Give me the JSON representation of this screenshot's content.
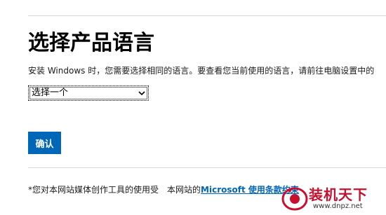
{
  "page": {
    "title": "选择产品语言",
    "instruction": "安装 Windows 时，您需要选择相同的语言。要查看您当前使用的语言，请前往电脑设置中的"
  },
  "language_select": {
    "selected": "选择一个"
  },
  "confirm_button": {
    "label": "确认"
  },
  "footer": {
    "note_prefix": "*您对本网站媒体创作工具的使用受",
    "note_middle": "本网站的",
    "terms_link": "Microsoft 使用条款",
    "note_suffix": "约束"
  },
  "watermark": {
    "brand": "装机天下",
    "url": "www.dnpz.net"
  },
  "colors": {
    "accent": "#0067b8",
    "watermark_red": "#c8102e"
  }
}
